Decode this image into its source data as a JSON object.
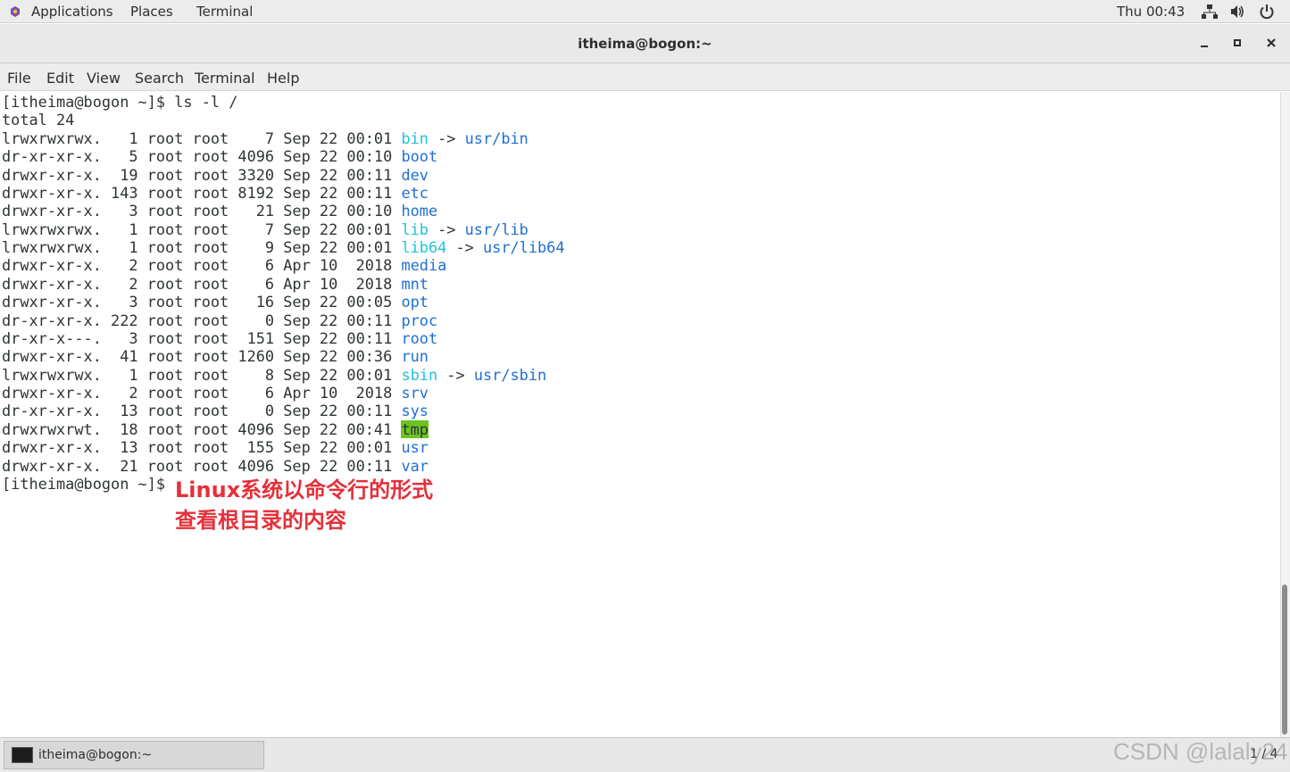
{
  "topbar": {
    "applications": "Applications",
    "places": "Places",
    "terminal": "Terminal",
    "clock": "Thu 00:43",
    "icons": [
      "network-icon",
      "volume-icon",
      "power-icon"
    ]
  },
  "window": {
    "title": "itheima@bogon:~",
    "controls": [
      "minimize",
      "maximize",
      "close"
    ]
  },
  "menubar": {
    "items": [
      "File",
      "Edit",
      "View",
      "Search",
      "Terminal",
      "Help"
    ]
  },
  "terminal": {
    "prompt": "[itheima@bogon ~]$ ",
    "command": "ls -l /",
    "total": "total 24",
    "entries": [
      {
        "meta": "lrwxrwxrwx.   1 root root    7 Sep 22 00:01 ",
        "name": "bin",
        "type": "link",
        "target": "usr/bin"
      },
      {
        "meta": "dr-xr-xr-x.   5 root root 4096 Sep 22 00:10 ",
        "name": "boot",
        "type": "dir"
      },
      {
        "meta": "drwxr-xr-x.  19 root root 3320 Sep 22 00:11 ",
        "name": "dev",
        "type": "dir"
      },
      {
        "meta": "drwxr-xr-x. 143 root root 8192 Sep 22 00:11 ",
        "name": "etc",
        "type": "dir"
      },
      {
        "meta": "drwxr-xr-x.   3 root root   21 Sep 22 00:10 ",
        "name": "home",
        "type": "dir"
      },
      {
        "meta": "lrwxrwxrwx.   1 root root    7 Sep 22 00:01 ",
        "name": "lib",
        "type": "link",
        "target": "usr/lib"
      },
      {
        "meta": "lrwxrwxrwx.   1 root root    9 Sep 22 00:01 ",
        "name": "lib64",
        "type": "link",
        "target": "usr/lib64"
      },
      {
        "meta": "drwxr-xr-x.   2 root root    6 Apr 10  2018 ",
        "name": "media",
        "type": "dir"
      },
      {
        "meta": "drwxr-xr-x.   2 root root    6 Apr 10  2018 ",
        "name": "mnt",
        "type": "dir"
      },
      {
        "meta": "drwxr-xr-x.   3 root root   16 Sep 22 00:05 ",
        "name": "opt",
        "type": "dir"
      },
      {
        "meta": "dr-xr-xr-x. 222 root root    0 Sep 22 00:11 ",
        "name": "proc",
        "type": "dir"
      },
      {
        "meta": "dr-xr-x---.   3 root root  151 Sep 22 00:11 ",
        "name": "root",
        "type": "dir"
      },
      {
        "meta": "drwxr-xr-x.  41 root root 1260 Sep 22 00:36 ",
        "name": "run",
        "type": "dir"
      },
      {
        "meta": "lrwxrwxrwx.   1 root root    8 Sep 22 00:01 ",
        "name": "sbin",
        "type": "link",
        "target": "usr/sbin"
      },
      {
        "meta": "drwxr-xr-x.   2 root root    6 Apr 10  2018 ",
        "name": "srv",
        "type": "dir"
      },
      {
        "meta": "dr-xr-xr-x.  13 root root    0 Sep 22 00:11 ",
        "name": "sys",
        "type": "dir"
      },
      {
        "meta": "drwxrwxrwt.  18 root root 4096 Sep 22 00:41 ",
        "name": "tmp",
        "type": "sticky"
      },
      {
        "meta": "drwxr-xr-x.  13 root root  155 Sep 22 00:01 ",
        "name": "usr",
        "type": "dir"
      },
      {
        "meta": "drwxr-xr-x.  21 root root 4096 Sep 22 00:11 ",
        "name": "var",
        "type": "dir"
      }
    ],
    "annotation": {
      "line1": "Linux系统以命令行的形式",
      "line2": "查看根目录的内容"
    }
  },
  "taskbar": {
    "task_label": "itheima@bogon:~",
    "pager": "1 / 4",
    "watermark": "CSDN @lalaly24"
  },
  "colors": {
    "directory": "#1f6fd4",
    "symlink": "#1fc4d6",
    "sticky_bg": "#6cc420",
    "annotation": "#e5303a"
  }
}
